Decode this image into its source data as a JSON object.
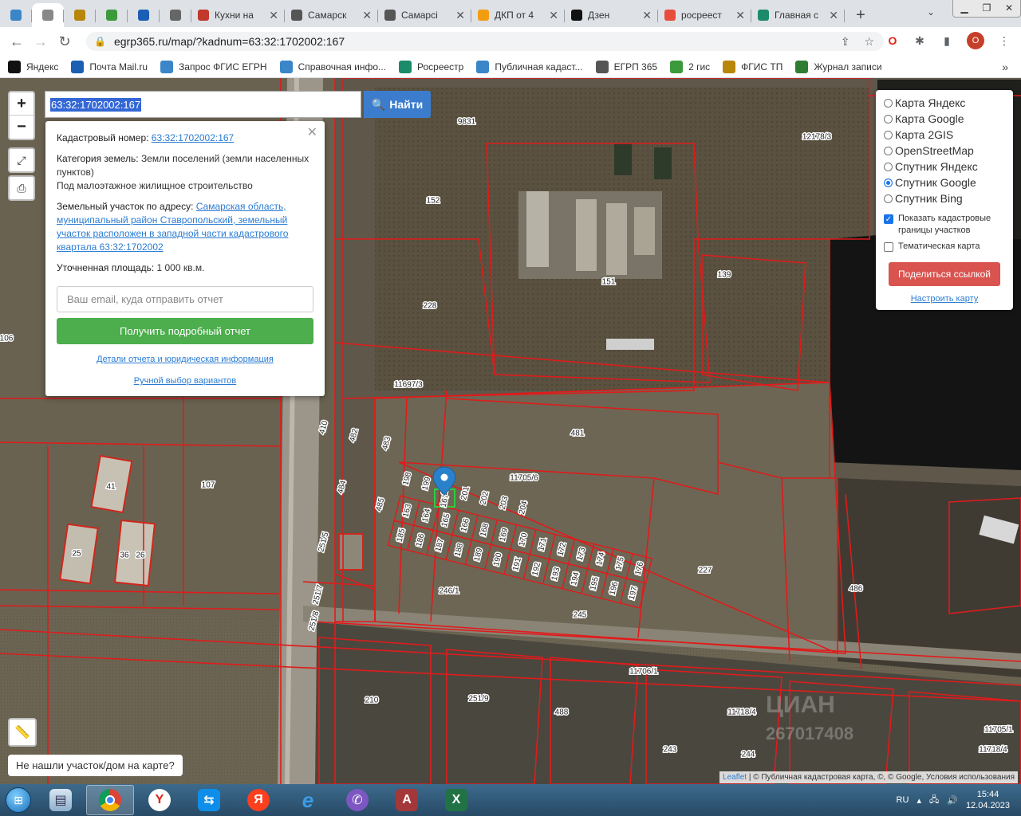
{
  "browser": {
    "tabs": [
      {
        "title": "",
        "icon": "pin-icon",
        "color": "#3a86c8"
      },
      {
        "title": "",
        "icon": "doc-icon",
        "color": "#888888"
      },
      {
        "title": "",
        "icon": "emblem-icon",
        "color": "#b8860b"
      },
      {
        "title": "",
        "icon": "mail-icon",
        "color": "#3b9a3b"
      },
      {
        "title": "",
        "icon": "window-icon",
        "color": "#1a5fb4"
      },
      {
        "title": "",
        "icon": "doc-icon",
        "color": "#666666"
      },
      {
        "title": "Кухни на",
        "icon": "brand-icon",
        "color": "#c0392b"
      },
      {
        "title": "Самарск",
        "icon": "doc-icon",
        "color": "#555555"
      },
      {
        "title": "Самарсі",
        "icon": "doc-icon",
        "color": "#555555"
      },
      {
        "title": "ДКП от 4",
        "icon": "cloud-icon",
        "color": "#f39c12"
      },
      {
        "title": "Дзен",
        "icon": "plus-icon",
        "color": "#111111"
      },
      {
        "title": "росреест",
        "icon": "yandex-icon",
        "color": "#e74c3c"
      },
      {
        "title": "Главная с",
        "icon": "gov-icon",
        "color": "#1b8b6a"
      }
    ],
    "new_tab": "+",
    "url": "egrp365.ru/map/?kadnum=63:32:1702002:167",
    "profile_initial": "O",
    "bookmarks": [
      {
        "label": "Яндекс",
        "color": "#111111"
      },
      {
        "label": "Почта Mail.ru",
        "color": "#1a5fb4"
      },
      {
        "label": "Запрос ФГИС ЕГРН",
        "color": "#3a86c8"
      },
      {
        "label": "Справочная инфо...",
        "color": "#3a86c8"
      },
      {
        "label": "Росреестр",
        "color": "#1b8b6a"
      },
      {
        "label": "Публичная кадаст...",
        "color": "#3a86c8"
      },
      {
        "label": "ЕГРП 365",
        "color": "#555555"
      },
      {
        "label": "2 гис",
        "color": "#3b9a3b"
      },
      {
        "label": "ФГИС ТП",
        "color": "#b8860b"
      },
      {
        "label": "Журнал записи",
        "color": "#2e7d32"
      }
    ],
    "bookmarks_more": "»"
  },
  "map": {
    "search_value": "63:32:1702002:167",
    "find_label": "Найти",
    "zoom_in": "+",
    "zoom_out": "−",
    "popup": {
      "cadnum_label": "Кадастровый номер:",
      "cadnum_value": "63:32:1702002:167",
      "category_label": "Категория земель:",
      "category_value": "Земли поселений (земли населенных пунктов)",
      "usage": "Под малоэтажное жилищное строительство",
      "address_label": "Земельный участок по адресу:",
      "address_value": "Самарская область, муниципальный район Ставропольский, земельный участок расположен в западной части кадастрового квартала 63:32:1702002",
      "area_label": "Уточненная площадь:",
      "area_value": "1 000 кв.м.",
      "email_placeholder": "Ваш email, куда отправить отчет",
      "report_button": "Получить подробный отчет",
      "details_link": "Детали отчета и юридическая информация",
      "manual_link": "Ручной выбор вариантов"
    },
    "layers": {
      "options": [
        "Карта Яндекс",
        "Карта Google",
        "Карта 2GIS",
        "OpenStreetMap",
        "Спутник Яндекс",
        "Спутник Google",
        "Спутник Bing"
      ],
      "selected": "Спутник Google",
      "show_borders": "Показать кадастровые границы участков",
      "thematic": "Тематическая карта",
      "share_button": "Поделиться ссылкой",
      "configure_link": "Настроить карту"
    },
    "not_found": "Не нашли участок/дом на карте?",
    "attribution_leaflet": "Leaflet",
    "attribution_rest": "| © Публичная кадастровая карта, ©, © Google, Условия использования",
    "labels": [
      "9831",
      "12178/3",
      "152",
      "151",
      "139",
      "228",
      "11697/3",
      "481",
      "11705/6",
      "482",
      "483",
      "484",
      "485",
      "106",
      "107",
      "41",
      "25",
      "36",
      "26",
      "227",
      "246/1",
      "245",
      "251/5",
      "251/7",
      "251/8",
      "410",
      "486",
      "11706/1",
      "210",
      "251/9",
      "488",
      "11718/4",
      "243",
      "244",
      "11705/1",
      "11718/4",
      "167"
    ],
    "lot_numbers": [
      "163",
      "164",
      "165",
      "166",
      "168",
      "169",
      "170",
      "171",
      "172",
      "173",
      "174",
      "175",
      "176",
      "177",
      "178",
      "179",
      "180",
      "181",
      "182",
      "183",
      "184",
      "185",
      "186",
      "187",
      "188",
      "189",
      "190",
      "191",
      "192",
      "193",
      "194",
      "195",
      "196",
      "197",
      "198",
      "199",
      "200",
      "201",
      "202",
      "203",
      "204"
    ]
  },
  "taskbar": {
    "apps": [
      "explorer",
      "chrome",
      "yandex-browser",
      "teamviewer",
      "yandex",
      "internet-explorer",
      "viber",
      "access",
      "excel"
    ],
    "lang": "RU",
    "time": "15:44",
    "date": "12.04.2023"
  }
}
